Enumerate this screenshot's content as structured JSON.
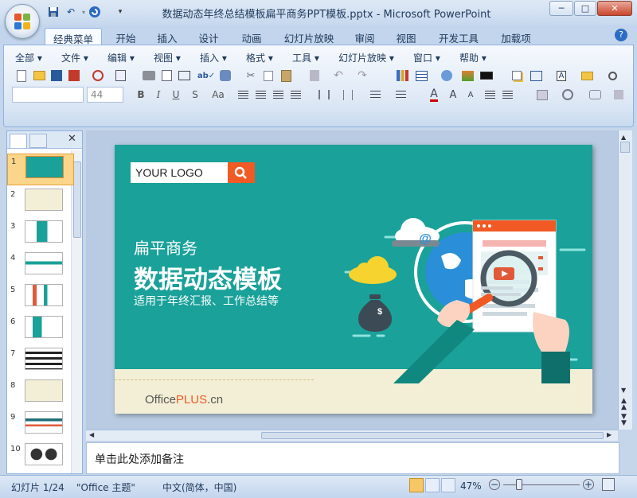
{
  "window": {
    "title": "数据动态年终总结模板扁平商务PPT模板.pptx - Microsoft PowerPoint",
    "controls": {
      "minimize": "─",
      "maximize": "□",
      "close": "✕"
    }
  },
  "quick_access": {
    "save": "save-icon",
    "undo": "undo-icon",
    "redo": "redo-icon"
  },
  "tabs": [
    {
      "label": "经典菜单",
      "active": true
    },
    {
      "label": "开始"
    },
    {
      "label": "插入"
    },
    {
      "label": "设计"
    },
    {
      "label": "动画"
    },
    {
      "label": "幻灯片放映"
    },
    {
      "label": "审阅"
    },
    {
      "label": "视图"
    },
    {
      "label": "开发工具"
    },
    {
      "label": "加载项"
    }
  ],
  "menus": [
    "全部 ▾",
    "文件 ▾",
    "编辑 ▾",
    "视图 ▾",
    "插入 ▾",
    "格式 ▾",
    "工具 ▾",
    "幻灯片放映 ▾",
    "窗口 ▾",
    "帮助 ▾"
  ],
  "formatting": {
    "font_size": "44",
    "bold": "B",
    "italic": "I",
    "underline": "U",
    "shadow": "S",
    "case": "Aa"
  },
  "slide_panel": {
    "thumbnails": [
      "1",
      "2",
      "3",
      "4",
      "5",
      "6",
      "7",
      "8",
      "9",
      "10"
    ],
    "selected": "1"
  },
  "slide": {
    "logo_text": "YOUR LOGO",
    "subtitle": "扁平商务",
    "title": "数据动态模板",
    "caption": "适用于年终汇报、工作总结等",
    "brand_prefix": "Office",
    "brand_accent": "PLUS",
    "brand_suffix": ".cn",
    "at_symbol": "@",
    "dollar": "$"
  },
  "notes": {
    "placeholder": "单击此处添加备注"
  },
  "status": {
    "slide_index": "幻灯片 1/24",
    "theme": "\"Office 主题\"",
    "language": "中文(简体，中国)",
    "zoom": "47%"
  },
  "colors": {
    "slide_bg": "#1aa199",
    "accent": "#f15a24",
    "ribbon": "#dde8f5"
  }
}
